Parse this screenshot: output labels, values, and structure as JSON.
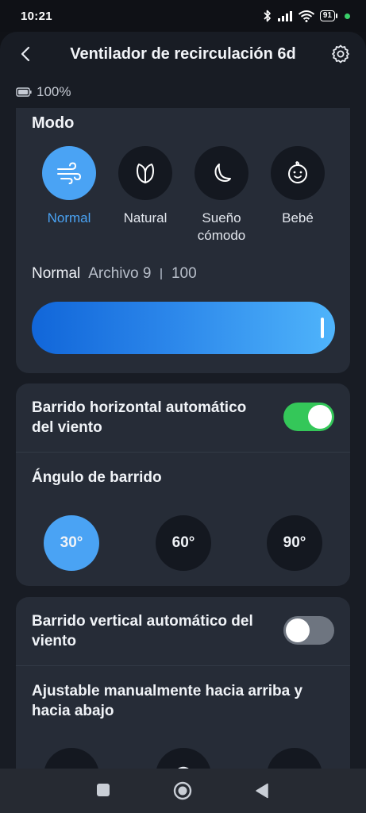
{
  "status_bar": {
    "time": "10:21",
    "battery": "91"
  },
  "header": {
    "title": "Ventilador de recirculación 6d",
    "back_icon": "chevron-left-icon",
    "settings_icon": "gear-icon"
  },
  "device": {
    "battery": "100%"
  },
  "mode_section": {
    "title": "Modo",
    "modes": [
      {
        "label": "Normal",
        "icon": "wind-icon",
        "active": true
      },
      {
        "label": "Natural",
        "icon": "leaf-icon",
        "active": false
      },
      {
        "label": "Sueño\ncómodo",
        "icon": "moon-icon",
        "active": false
      },
      {
        "label": "Bebé",
        "icon": "baby-face-icon",
        "active": false
      }
    ],
    "current_mode": "Normal",
    "file_label": "Archivo 9",
    "speed_value": "100",
    "speed_level": 1.0
  },
  "horizontal_sweep": {
    "label": "Barrido horizontal automático del viento",
    "enabled": true,
    "angle_title": "Ángulo de barrido",
    "angles": [
      {
        "label": "30°",
        "active": true
      },
      {
        "label": "60°",
        "active": false
      },
      {
        "label": "90°",
        "active": false
      }
    ]
  },
  "vertical_sweep": {
    "label": "Barrido vertical automático del viento",
    "enabled": false,
    "manual_title": "Ajustable manualmente hacia arriba y hacia abajo"
  },
  "colors": {
    "accent": "#4aa3f4",
    "toggle_on": "#34c759",
    "card": "#262c37",
    "background": "#181c24"
  }
}
